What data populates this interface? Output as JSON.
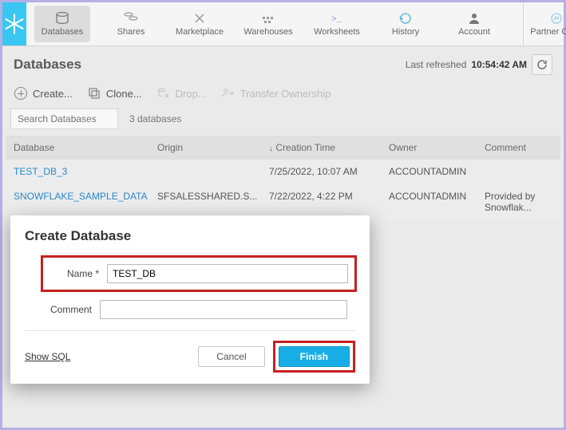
{
  "nav": {
    "items": [
      {
        "label": "Databases",
        "icon": "database-icon",
        "active": true
      },
      {
        "label": "Shares",
        "icon": "shares-icon"
      },
      {
        "label": "Marketplace",
        "icon": "marketplace-icon"
      },
      {
        "label": "Warehouses",
        "icon": "warehouses-icon"
      },
      {
        "label": "Worksheets",
        "icon": "worksheets-icon"
      },
      {
        "label": "History",
        "icon": "history-icon"
      },
      {
        "label": "Account",
        "icon": "account-icon"
      }
    ],
    "partner_label": "Partner Conn"
  },
  "page": {
    "title": "Databases",
    "last_refreshed_label": "Last refreshed",
    "last_refreshed_time": "10:54:42 AM"
  },
  "toolbar": {
    "create": "Create...",
    "clone": "Clone...",
    "drop": "Drop...",
    "transfer": "Transfer Ownership"
  },
  "search": {
    "placeholder": "Search Databases"
  },
  "list": {
    "count_text": "3 databases"
  },
  "table": {
    "headers": {
      "database": "Database",
      "origin": "Origin",
      "creation": "Creation Time",
      "owner": "Owner",
      "comment": "Comment"
    },
    "rows": [
      {
        "database": "TEST_DB_3",
        "origin": "",
        "creation": "7/25/2022, 10:07 AM",
        "owner": "ACCOUNTADMIN",
        "comment": ""
      },
      {
        "database": "SNOWFLAKE_SAMPLE_DATA",
        "origin": "SFSALESSHARED.S...",
        "creation": "7/22/2022, 4:22 PM",
        "owner": "ACCOUNTADMIN",
        "comment": "Provided by Snowflak..."
      }
    ]
  },
  "modal": {
    "title": "Create Database",
    "name_label": "Name *",
    "name_value": "TEST_DB",
    "comment_label": "Comment",
    "comment_value": "",
    "show_sql": "Show SQL",
    "cancel": "Cancel",
    "finish": "Finish"
  }
}
